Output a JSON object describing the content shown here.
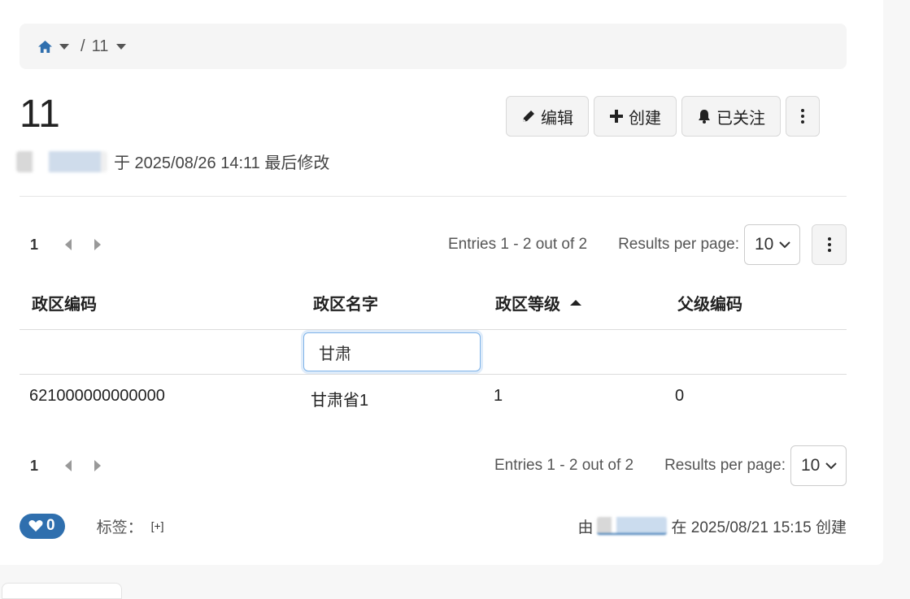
{
  "breadcrumb": {
    "current": "11",
    "separator": "/"
  },
  "page": {
    "title": "11",
    "modified_text": "于 2025/08/26 14:11 最后修改"
  },
  "actions": {
    "edit": "编辑",
    "create": "创建",
    "following": "已关注"
  },
  "pager_top": {
    "page": "1",
    "entries": "Entries 1 - 2 out of 2",
    "rpp_label": "Results per page:",
    "rpp_value": "10"
  },
  "pager_bottom": {
    "page": "1",
    "entries": "Entries 1 - 2 out of 2",
    "rpp_label": "Results per page:",
    "rpp_value": "10"
  },
  "table": {
    "columns": [
      "政区编码",
      "政区名字",
      "政区等级",
      "父级编码"
    ],
    "sorted_column": "政区等级",
    "sort_direction": "ascending",
    "filter_value": "甘肃",
    "rows": [
      [
        "621000000000000",
        "甘肃省1",
        "1",
        "0"
      ]
    ]
  },
  "footer": {
    "likes": "0",
    "tags_label": "标签：",
    "tags_add": "[+]",
    "created_prefix": "由",
    "created_text": "在 2025/08/21 15:15 创建"
  },
  "colors": {
    "accent": "#2f6fae",
    "focus": "#7eb3e8"
  },
  "icons": [
    "home-icon",
    "pencil-icon",
    "plus-icon",
    "bell-icon",
    "kebab-icon",
    "heart-icon",
    "chevron-down-icon"
  ]
}
